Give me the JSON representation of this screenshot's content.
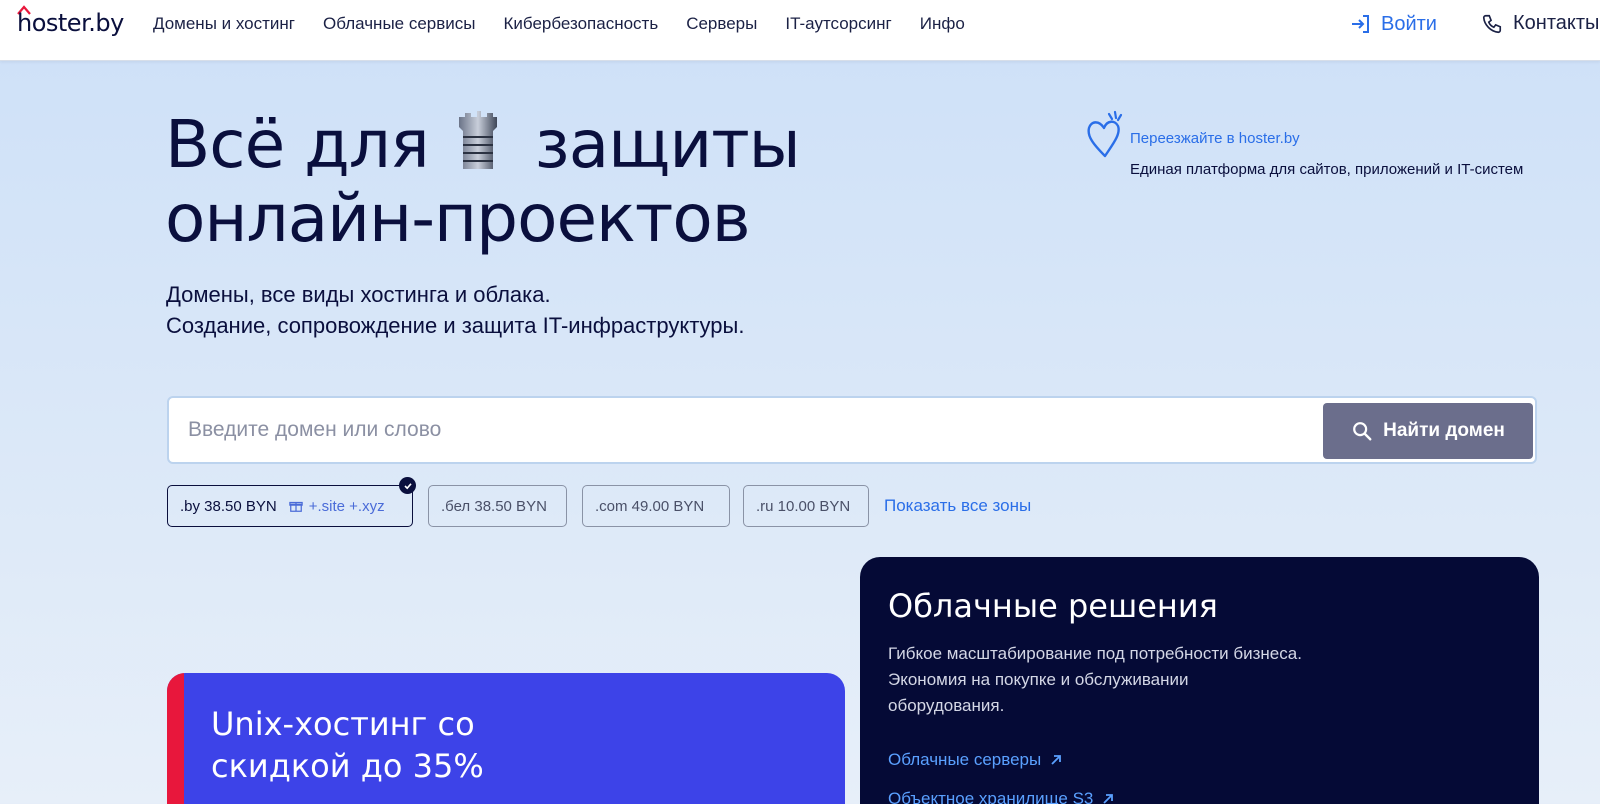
{
  "header": {
    "logo": "hoster.by",
    "nav": [
      "Домены и хостинг",
      "Облачные сервисы",
      "Кибербезопасность",
      "Серверы",
      "IT-аутсорсинг",
      "Инфо"
    ],
    "login": "Войти",
    "contacts": "Контакты"
  },
  "hero": {
    "title_line1_a": "Всё для",
    "title_line1_b": "защиты",
    "title_line2": "онлайн-проектов",
    "subtitle_line1": "Домены, все виды хостинга и облака.",
    "subtitle_line2": "Создание, сопровождение и защита IT-инфраструктуры."
  },
  "promo": {
    "link": "Переезжайте в hoster.by",
    "text": "Единая платформа для сайтов, приложений и IT-систем"
  },
  "search": {
    "placeholder": "Введите домен или слово",
    "button": "Найти домен"
  },
  "zones": {
    "items": [
      {
        "label": ".by 38.50 BYN",
        "gift": "+.site +.xyz"
      },
      {
        "label": ".бел 38.50 BYN"
      },
      {
        "label": ".com 49.00 BYN"
      },
      {
        "label": ".ru 10.00 BYN"
      }
    ],
    "show_all": "Показать все зоны"
  },
  "unix_card": {
    "title_line1": "Unix-хостинг со",
    "title_line2": "скидкой до 35%"
  },
  "cloud_card": {
    "title": "Облачные решения",
    "desc": "Гибкое масштабирование под потребности бизнеса. Экономия на покупке и обслуживании оборудования.",
    "links": [
      "Облачные серверы",
      "Объектное хранилище S3"
    ]
  },
  "colors": {
    "accent_blue": "#2a6ee8",
    "navy": "#0a0f3d",
    "unix_card": "#3d43e8",
    "unix_stripe": "#e8173c",
    "cloud_card": "#050a36",
    "search_button": "#6b6e8c"
  },
  "icons": [
    "login-icon",
    "phone-icon",
    "tower-icon",
    "heart-icon",
    "search-icon",
    "gift-icon",
    "check-icon",
    "arrow-up-right-icon"
  ]
}
